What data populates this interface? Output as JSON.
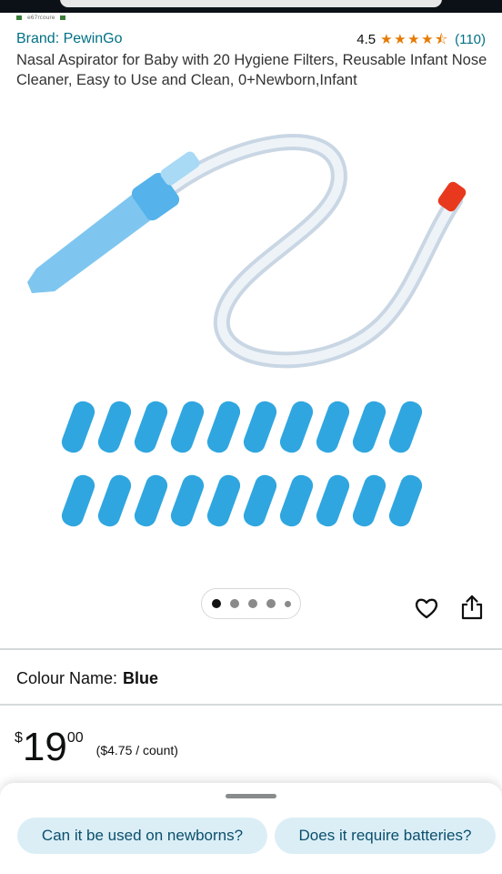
{
  "crumb": {
    "text": "e67rcoure"
  },
  "product": {
    "brand": "Brand: PewinGo",
    "rating_value": "4.5",
    "rating_count": "(110)",
    "stars": "4.5",
    "title": "Nasal Aspirator for Baby with 20 Hygiene Filters, Reusable Infant Nose Cleaner, Easy to Use and Clean, 0+Newborn,Infant"
  },
  "gallery": {
    "dots": 5,
    "active_index": 0
  },
  "icons": {
    "wishlist": "heart-icon",
    "share": "share-icon",
    "star": "star-icon"
  },
  "colour": {
    "label": "Colour Name:",
    "value": "Blue"
  },
  "price": {
    "currency": "$",
    "whole": "19",
    "fraction": "00",
    "unit_price": "($4.75 / count)"
  },
  "suggestions": [
    {
      "label": "Can it be used on newborns?"
    },
    {
      "label": "Does it require batteries?"
    }
  ],
  "colors": {
    "link": "#007185",
    "star": "#e67a00",
    "chip_bg": "#dbeef6",
    "filter_blue": "#2fa6e0",
    "tip_red": "#e8391e"
  }
}
